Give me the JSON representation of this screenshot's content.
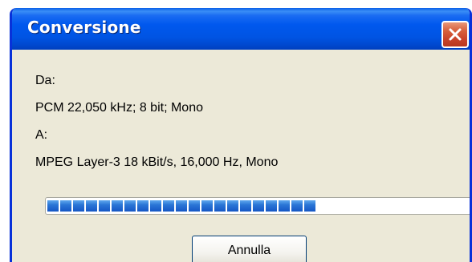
{
  "window": {
    "title": "Conversione",
    "close_icon": "close-icon"
  },
  "conversion": {
    "from_label": "Da:",
    "from_format": "PCM 22,050 kHz; 8 bit; Mono",
    "to_label": "A:",
    "to_format": "MPEG Layer-3 18 kBit/s, 16,000 Hz, Mono"
  },
  "progress": {
    "fraction": 0.64
  },
  "buttons": {
    "cancel_label": "Annulla"
  },
  "colors": {
    "titlebar": "#0054e3",
    "dialog_bg": "#ece9d8",
    "close_button": "#c9432a",
    "progress_fill": "#2b76d6"
  }
}
